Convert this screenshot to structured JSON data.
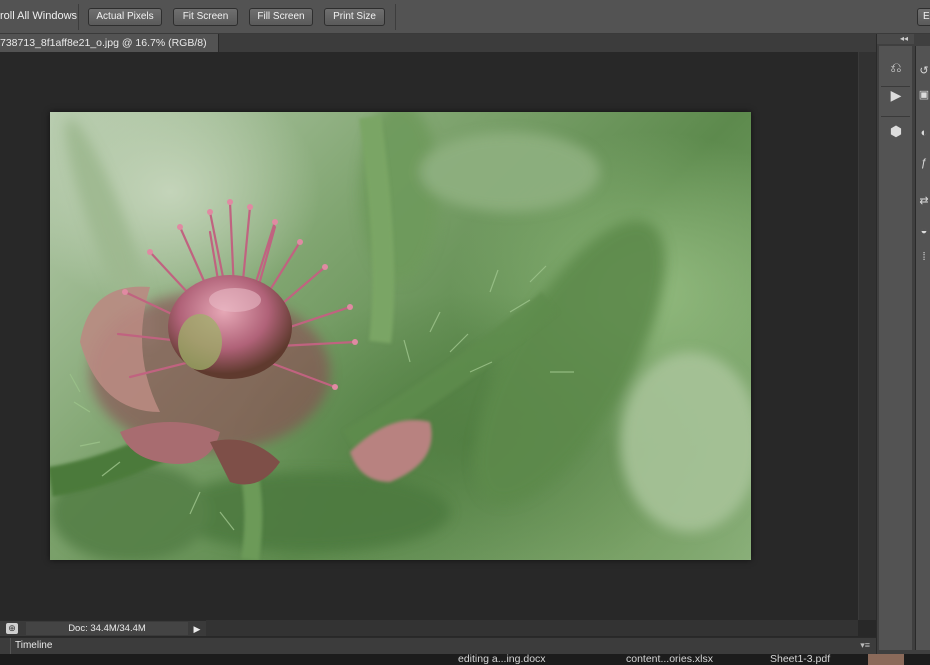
{
  "options_bar": {
    "scroll_all_windows": "roll All Windows",
    "buttons": [
      "Actual Pixels",
      "Fit Screen",
      "Fill Screen",
      "Print Size"
    ],
    "right_button": "Er"
  },
  "document": {
    "tab_title": "738713_8f1aff8e21_o.jpg @ 16.7% (RGB/8)"
  },
  "status_bar": {
    "doc_size": "Doc: 34.4M/34.4M",
    "arrow": "▶"
  },
  "timeline": {
    "tab_label": "Timeline",
    "menu": "▾≡"
  },
  "dock": {
    "collapse": "◂◂",
    "col1_icons": [
      "history-icon",
      "play-icon",
      "3d-icon"
    ],
    "col1_glyphs": [
      "⎌",
      "▶",
      "⬢"
    ],
    "col2_glyphs": [
      "↺",
      "▣",
      "◐",
      "ƒ",
      "⇄",
      "◒",
      "⁞"
    ]
  },
  "taskbar": {
    "items": [
      "editing a...ing.docx",
      "content...ories.xlsx",
      "Sheet1-3.pdf"
    ]
  },
  "colors": {
    "ui_dark": "#282828",
    "ui_panel": "#535353"
  }
}
